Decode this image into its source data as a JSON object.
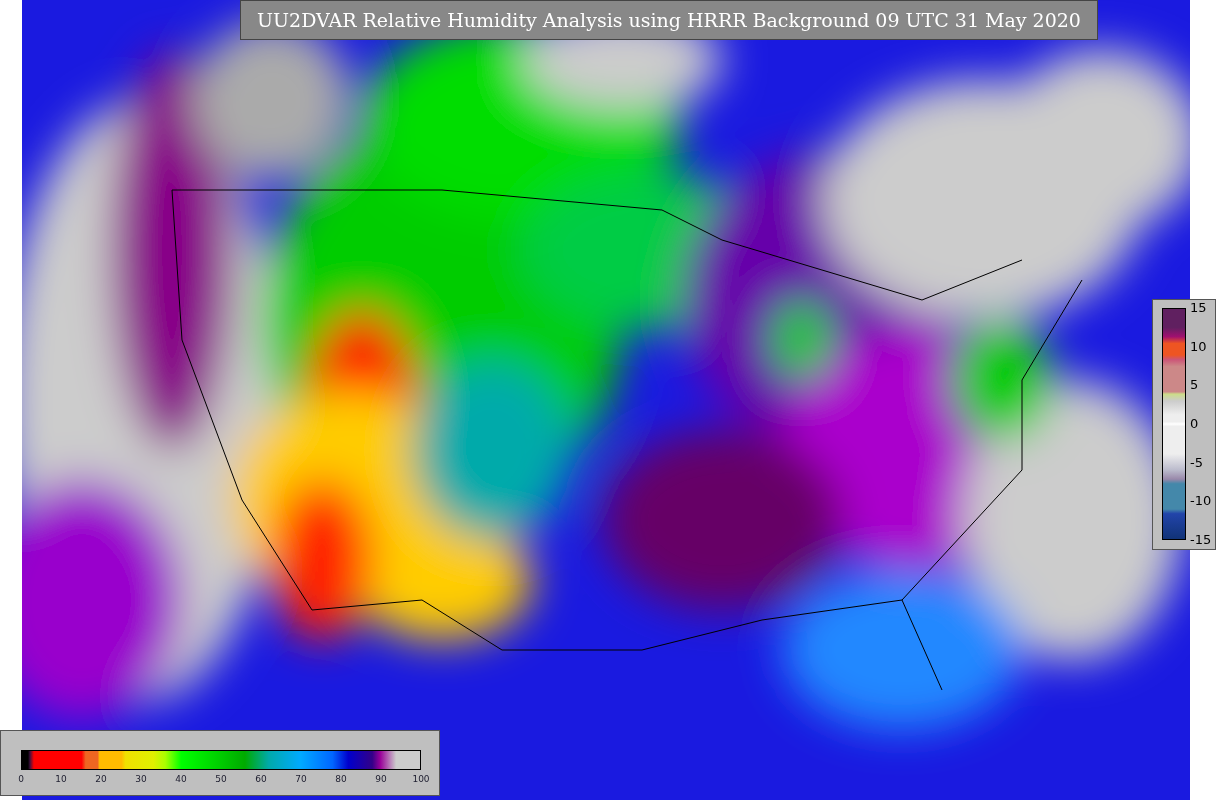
{
  "map": {
    "title": "UU2DVAR Relative Humidity Analysis using HRRR Background 09 UTC 31 May 2020"
  },
  "humidity_scale": {
    "ticks": [
      "0",
      "10",
      "20",
      "30",
      "40",
      "50",
      "60",
      "70",
      "80",
      "90",
      "100"
    ]
  },
  "difference_scale": {
    "ticks": [
      "15",
      "10",
      "5",
      "0",
      "-5",
      "-10",
      "-15"
    ]
  }
}
